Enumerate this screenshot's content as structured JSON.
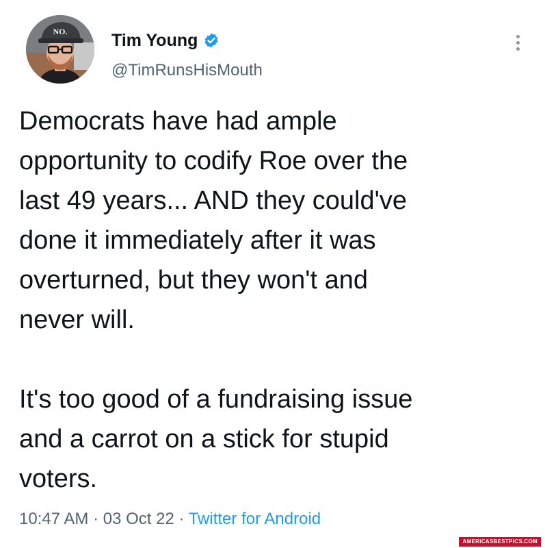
{
  "author": {
    "name": "Tim Young",
    "handle": "@TimRunsHisMouth",
    "verified": true,
    "avatar_hat_text": "NO."
  },
  "tweet": {
    "paragraphs": [
      [
        "Democrats have had ample",
        "opportunity to codify Roe over the",
        "last 49 years... AND they could've",
        "done it immediately after it was",
        "overturned, but they won't and",
        "never will."
      ],
      [
        "It's too good of a fundraising issue",
        "and a carrot on a stick for stupid",
        "voters."
      ]
    ]
  },
  "meta": {
    "time": "10:47 AM",
    "separator": " · ",
    "date": "03 Oct 22",
    "source": "Twitter for Android"
  },
  "icons": {
    "verified": "verified-badge-icon",
    "more": "more-vertical-icon"
  },
  "colors": {
    "text": "#0f1419",
    "secondary": "#536471",
    "link": "#1d9bf0",
    "verified": "#1d9bf0"
  },
  "watermark": "AMERICASBESTPICS.COM"
}
